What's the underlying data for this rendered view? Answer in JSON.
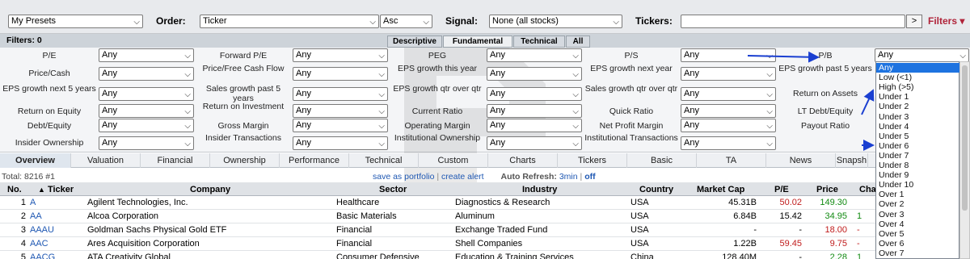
{
  "topbar": {
    "presets_value": "My Presets",
    "order_label": "Order:",
    "order_value": "Ticker",
    "order_dir": "Asc",
    "signal_label": "Signal:",
    "signal_value": "None (all stocks)",
    "tickers_label": "Tickers:",
    "tickers_value": "",
    "go_button": ">",
    "filters_link": "Filters"
  },
  "filters_bar": {
    "count_label": "Filters: 0",
    "tabs": [
      "Descriptive",
      "Fundamental",
      "Technical",
      "All"
    ],
    "active_tab": "Fundamental"
  },
  "filter_rows": [
    [
      {
        "label": "P/E",
        "value": "Any"
      },
      {
        "label": "Forward P/E",
        "value": "Any"
      },
      {
        "label": "PEG",
        "value": "Any"
      },
      {
        "label": "P/S",
        "value": "Any"
      },
      {
        "label": "P/B",
        "value": "Any"
      }
    ],
    [
      {
        "label": "Price/Cash",
        "value": "Any"
      },
      {
        "label": "Price/Free Cash Flow",
        "value": "Any"
      },
      {
        "label": "EPS growth this year",
        "value": "Any"
      },
      {
        "label": "EPS growth next year",
        "value": "Any"
      },
      {
        "label": "EPS growth past 5 years",
        "value": ""
      }
    ],
    [
      {
        "label": "EPS growth next 5 years",
        "value": "Any"
      },
      {
        "label": "Sales growth past 5 years",
        "value": "Any"
      },
      {
        "label": "EPS growth qtr over qtr",
        "value": "Any"
      },
      {
        "label": "Sales growth qtr over qtr",
        "value": "Any"
      },
      {
        "label": "Return on Assets",
        "value": ""
      }
    ],
    [
      {
        "label": "Return on Equity",
        "value": "Any"
      },
      {
        "label": "Return on Investment",
        "value": "Any"
      },
      {
        "label": "Current Ratio",
        "value": "Any"
      },
      {
        "label": "Quick Ratio",
        "value": "Any"
      },
      {
        "label": "LT Debt/Equity",
        "value": ""
      }
    ],
    [
      {
        "label": "Debt/Equity",
        "value": "Any"
      },
      {
        "label": "Gross Margin",
        "value": "Any"
      },
      {
        "label": "Operating Margin",
        "value": "Any"
      },
      {
        "label": "Net Profit Margin",
        "value": "Any"
      },
      {
        "label": "Payout Ratio",
        "value": ""
      }
    ],
    [
      {
        "label": "Insider Ownership",
        "value": "Any"
      },
      {
        "label": "Insider Transactions",
        "value": "Any"
      },
      {
        "label": "Institutional Ownership",
        "value": "Any"
      },
      {
        "label": "Institutional Transactions",
        "value": "Any"
      },
      {
        "label": "",
        "value": ""
      }
    ]
  ],
  "view_tabs": [
    "Overview",
    "Valuation",
    "Financial",
    "Ownership",
    "Performance",
    "Technical",
    "Custom",
    "Charts",
    "Tickers",
    "Basic",
    "TA",
    "News",
    "Snapsh"
  ],
  "active_view": "Overview",
  "summary": {
    "total": "Total: 8216 #1",
    "save_portfolio": "save as portfolio",
    "separator": "|",
    "create_alert": "create alert",
    "auto_refresh": "Auto Refresh:",
    "refresh_interval": "3min",
    "refresh_sep": "|",
    "refresh_off": "off"
  },
  "table": {
    "headers": [
      "No.",
      "Ticker",
      "Company",
      "Sector",
      "Industry",
      "Country",
      "Market Cap",
      "P/E",
      "Price",
      "Cha"
    ],
    "sort_indicator": "▲",
    "rows": [
      {
        "no": "1",
        "ticker": "A",
        "company": "Agilent Technologies, Inc.",
        "sector": "Healthcare",
        "industry": "Diagnostics & Research",
        "country": "USA",
        "mcap": "45.31B",
        "pe": "50.02",
        "price": "149.30",
        "change": "",
        "pe_color": "red",
        "price_color": "green"
      },
      {
        "no": "2",
        "ticker": "AA",
        "company": "Alcoa Corporation",
        "sector": "Basic Materials",
        "industry": "Aluminum",
        "country": "USA",
        "mcap": "6.84B",
        "pe": "15.42",
        "price": "34.95",
        "change": "1",
        "pe_color": "black",
        "price_color": "green"
      },
      {
        "no": "3",
        "ticker": "AAAU",
        "company": "Goldman Sachs Physical Gold ETF",
        "sector": "Financial",
        "industry": "Exchange Traded Fund",
        "country": "USA",
        "mcap": "-",
        "pe": "-",
        "price": "18.00",
        "change": "-",
        "pe_color": "black",
        "price_color": "red"
      },
      {
        "no": "4",
        "ticker": "AAC",
        "company": "Ares Acquisition Corporation",
        "sector": "Financial",
        "industry": "Shell Companies",
        "country": "USA",
        "mcap": "1.22B",
        "pe": "59.45",
        "price": "9.75",
        "change": "-",
        "pe_color": "red",
        "price_color": "red"
      },
      {
        "no": "5",
        "ticker": "AACG",
        "company": "ATA Creativity Global",
        "sector": "Consumer Defensive",
        "industry": "Education & Training Services",
        "country": "China",
        "mcap": "128.40M",
        "pe": "-",
        "price": "2.28",
        "change": "1",
        "pe_color": "black",
        "price_color": "green"
      }
    ]
  },
  "dropdown": {
    "options": [
      "Any",
      "Low (<1)",
      "High (>5)",
      "Under 1",
      "Under 2",
      "Under 3",
      "Under 4",
      "Under 5",
      "Under 6",
      "Under 7",
      "Under 8",
      "Under 9",
      "Under 10",
      "Over 1",
      "Over 2",
      "Over 3",
      "Over 4",
      "Over 5",
      "Over 6",
      "Over 7"
    ],
    "highlighted": "Any"
  },
  "colors": {
    "link": "#1f58b3",
    "positive": "#118a11",
    "negative": "#c01c1c",
    "highlight": "#1e73e0",
    "annotation_arrow": "#1a3fd1",
    "filters_link": "#b0243a"
  }
}
